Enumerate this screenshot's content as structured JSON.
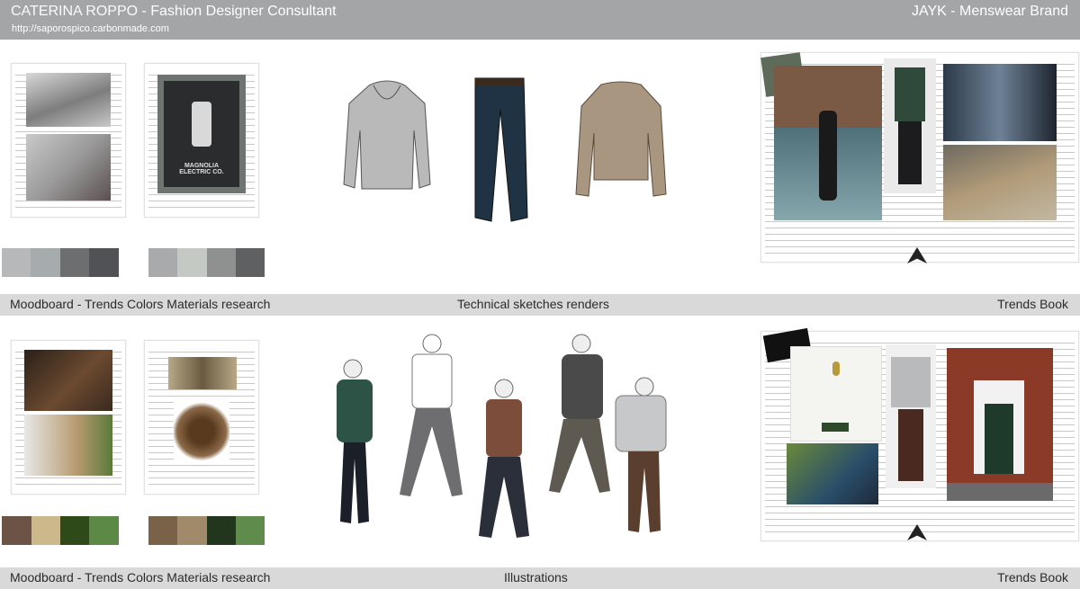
{
  "header": {
    "name": "CATERINA ROPPO",
    "separator": " - ",
    "role": "Fashion Designer Consultant",
    "url": "http://saporospico.carbonmade.com",
    "brand": "JAYK",
    "brand_separator": " - ",
    "brand_role": "Menswear Brand"
  },
  "row1": {
    "left_label": "Moodboard - Trends Colors Materials research",
    "center_label": "Technical sketches renders",
    "right_label": "Trends Book"
  },
  "row2": {
    "left_label": "Moodboard - Trends Colors Materials research",
    "center_label": "Illustrations",
    "right_label": "Trends Book"
  },
  "moodboard_poster_text": "MAGNOLIA ELECTRIC CO.",
  "swatches": {
    "row1_a": [
      "#b6b8ba",
      "#a6acad",
      "#6d6e70",
      "#515255"
    ],
    "row1_b": [
      "#a9aaab",
      "#c4c9c4",
      "#8f9090",
      "#5f6062"
    ],
    "row2_a": [
      "#6b5446",
      "#cbb98c",
      "#2d4a18",
      "#5c8a46"
    ],
    "row2_b": [
      "#7a6249",
      "#a08a6a",
      "#21361d",
      "#5f8c4c"
    ]
  }
}
